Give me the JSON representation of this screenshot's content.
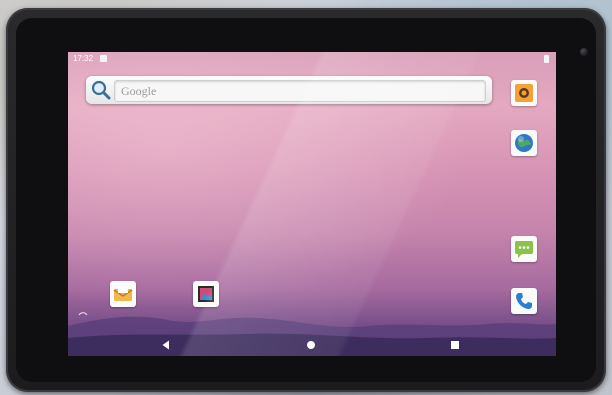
{
  "status_bar": {
    "time": "17:32"
  },
  "search": {
    "placeholder": "Google"
  },
  "icons": {
    "search": "search-icon",
    "camera_app": "camera-app-icon",
    "browser_app": "browser-app-icon",
    "messaging_app": "messaging-app-icon",
    "phone_app": "phone-app-icon",
    "email_app": "email-app-icon",
    "gallery_app": "gallery-app-icon"
  },
  "navigation": {
    "back": "back-icon",
    "home": "home-icon",
    "recents": "recents-icon"
  },
  "colors": {
    "wallpaper_top": "#e4a8c0",
    "wallpaper_bottom": "#4a3670",
    "device_frame": "#1c1c1f"
  }
}
